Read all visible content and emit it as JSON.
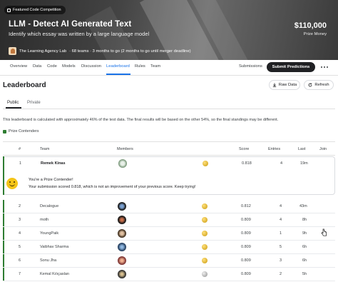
{
  "banner": {
    "badge": "Featured Code Competition",
    "title": "LLM - Detect AI Generated Text",
    "subtitle": "Identify which essay was written by a large language model",
    "host": "The Learning Agency Lab",
    "meta": "· 68 teams · 3 months to go (2 months to go until merger deadline)",
    "prize_amount": "$110,000",
    "prize_label": "Prize Money"
  },
  "nav": {
    "tabs": [
      "Overview",
      "Data",
      "Code",
      "Models",
      "Discussion",
      "Leaderboard",
      "Rules",
      "Team"
    ],
    "active": "Leaderboard",
    "submissions": "Submissions",
    "submit": "Submit Predictions"
  },
  "leaderboard": {
    "title": "Leaderboard",
    "raw_data": "Raw Data",
    "refresh": "Refresh",
    "subtabs": [
      "Public",
      "Private"
    ],
    "notice": "This leaderboard is calculated with approximately 46% of the test data. The final results will be based on the other 54%, so the final standings may be different.",
    "legend": "Prize Contenders",
    "columns": [
      "#",
      "Team",
      "Members",
      "Score",
      "Entries",
      "Last",
      "Join"
    ],
    "rows": [
      {
        "rank": "1",
        "team": "Remek Kinas",
        "score": "0.818",
        "entries": "4",
        "last": "19m",
        "medal": "gold"
      },
      {
        "rank": "2",
        "team": "Decalogue",
        "score": "0.812",
        "entries": "4",
        "last": "43m",
        "medal": "gold"
      },
      {
        "rank": "3",
        "team": "moth",
        "score": "0.809",
        "entries": "4",
        "last": "8h",
        "medal": "gold"
      },
      {
        "rank": "4",
        "team": "YoungPaik",
        "score": "0.809",
        "entries": "1",
        "last": "9h",
        "medal": "gold"
      },
      {
        "rank": "5",
        "team": "Vaibhav Sharma",
        "score": "0.809",
        "entries": "5",
        "last": "6h",
        "medal": "gold"
      },
      {
        "rank": "6",
        "team": "Sonu Jha",
        "score": "0.809",
        "entries": "3",
        "last": "6h",
        "medal": "gold"
      },
      {
        "rank": "7",
        "team": "Kemal Kılıçaslan",
        "score": "0.809",
        "entries": "2",
        "last": "5h",
        "medal": "silver"
      }
    ],
    "contender_title": "You're a Prize Contender!",
    "contender_msg": "Your submission scored 0.818, which is not an improvement of your previous score. Keep trying!"
  }
}
